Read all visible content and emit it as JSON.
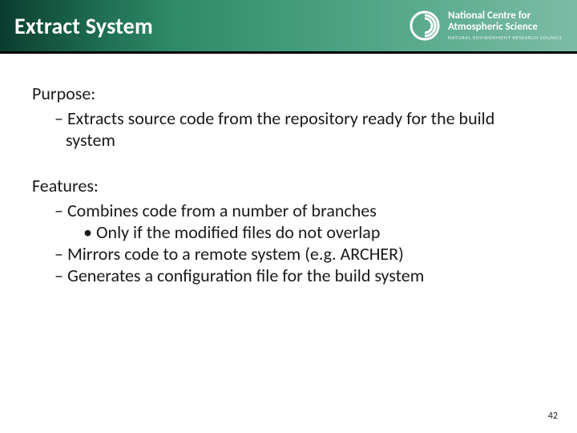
{
  "header": {
    "title": "Extract System",
    "brand": {
      "line1": "National Centre for",
      "line2": "Atmospheric Science",
      "sub": "NATURAL ENVIRONMENT RESEARCH COUNCIL"
    }
  },
  "body": {
    "purpose": {
      "label": "Purpose:",
      "items": [
        "Extracts source code from the repository ready for the build system"
      ]
    },
    "features": {
      "label": "Features:",
      "items": [
        {
          "text": "Combines code from a number of branches",
          "sub": [
            "Only if the modified files do not overlap"
          ]
        },
        {
          "text": "Mirrors code to a remote system (e.g. ARCHER)"
        },
        {
          "text": "Generates a configuration file for the build system"
        }
      ]
    }
  },
  "page_number": "42",
  "colors": {
    "header_dark": "#0b3d2e",
    "header_light": "#7bbca5"
  }
}
